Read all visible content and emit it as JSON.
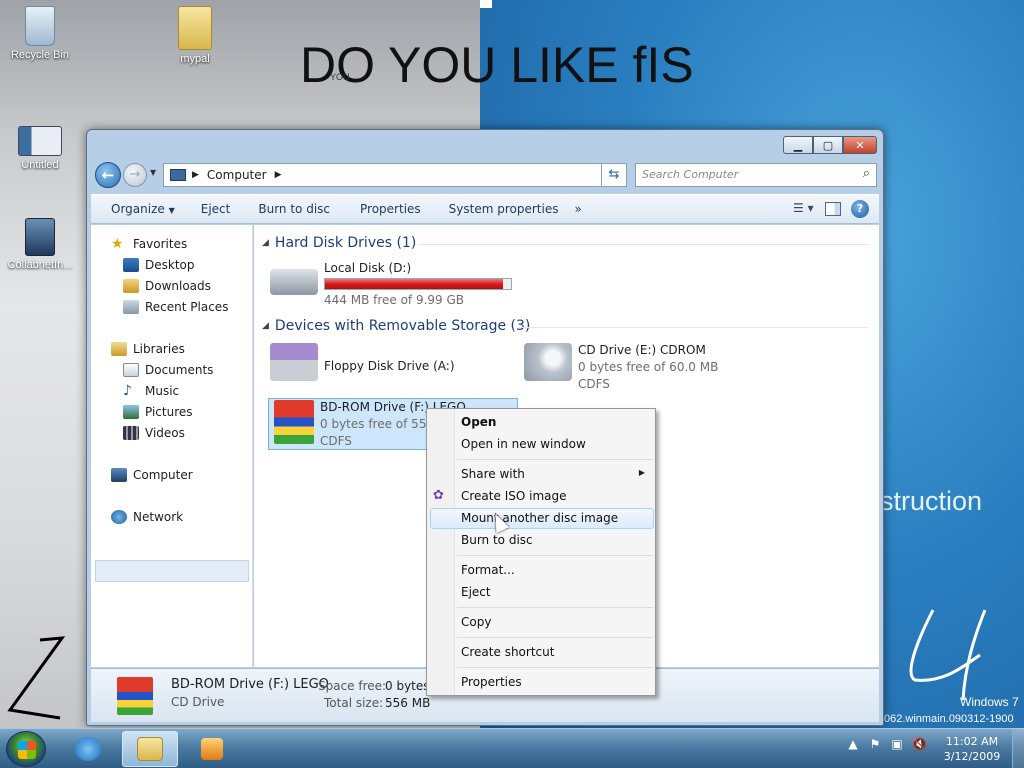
{
  "desktop": {
    "overlay_text": "DO YOU LIKE fIS",
    "overlay_small": "YOU",
    "construction": "struction",
    "watermark_line1": "Windows 7",
    "watermark_line2": "062.winmain.090312-1900",
    "icons": [
      {
        "label": "Recycle Bin",
        "icon": "recycle-bin-icon"
      },
      {
        "label": "mypal",
        "icon": "folder-icon"
      },
      {
        "label": "Untitled",
        "icon": "document-icon"
      },
      {
        "label": "CollabnetIn...",
        "icon": "setup-computer-icon"
      }
    ]
  },
  "window": {
    "address": {
      "root_label": "Computer"
    },
    "search_placeholder": "Search Computer",
    "toolbar": {
      "organize": "Organize",
      "eject": "Eject",
      "burn": "Burn to disc",
      "properties": "Properties",
      "system_properties": "System properties",
      "more": "»"
    },
    "nav_pane": {
      "favorites": "Favorites",
      "desktop": "Desktop",
      "downloads": "Downloads",
      "recent": "Recent Places",
      "libraries": "Libraries",
      "documents": "Documents",
      "music": "Music",
      "pictures": "Pictures",
      "videos": "Videos",
      "computer": "Computer",
      "network": "Network"
    },
    "groups": {
      "hdd": "Hard Disk Drives (1)",
      "removable": "Devices with Removable Storage (3)"
    },
    "drives": {
      "local_disk": {
        "name": "Local Disk (D:)",
        "free": "444 MB free of 9.99 GB",
        "used_fraction": 0.957
      },
      "floppy": {
        "name": "Floppy Disk Drive (A:)"
      },
      "cd": {
        "name": "CD Drive (E:) CDROM",
        "free": "0 bytes free of 60.0 MB",
        "fs": "CDFS"
      },
      "bd": {
        "name": "BD-ROM Drive (F:) LEGO",
        "free": "0 bytes free of 556 MB",
        "fs": "CDFS"
      }
    },
    "details": {
      "title": "BD-ROM Drive (F:) LEGO",
      "type": "CD Drive",
      "space_free_label": "Space free:",
      "space_free": "0 bytes",
      "total_size_label": "Total size:",
      "total_size": "556 MB"
    }
  },
  "context_menu": {
    "open": "Open",
    "open_new": "Open in new window",
    "share": "Share with",
    "create_iso": "Create ISO image",
    "mount": "Mount another disc image",
    "burn": "Burn to disc",
    "format": "Format...",
    "eject": "Eject",
    "copy": "Copy",
    "shortcut": "Create shortcut",
    "properties": "Properties"
  },
  "taskbar": {
    "time": "11:02 AM",
    "date": "3/12/2009"
  }
}
